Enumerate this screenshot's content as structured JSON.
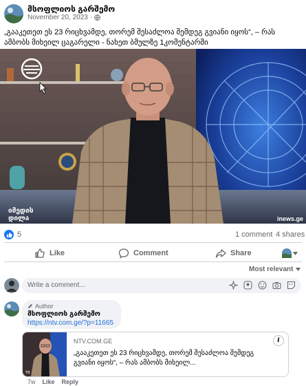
{
  "post": {
    "page_name": "მსოფლიოს გარშემო",
    "date": "November 20, 2023",
    "privacy_icon": "globe-icon",
    "more_icon": "more-icon",
    "caption": "„გააკეთეთ ეს 23 რიცხვამდე, თორემ შესაძლოა შემდეგ გვიანი იყოს“, – რას ამბობს მიხეილ ცაგარელი - ნახეთ ბმულზე 1კომენტარში"
  },
  "photo": {
    "logo_text": "იმედის დილა",
    "watermark": "inews.ge"
  },
  "stats": {
    "likes": "5",
    "comments": "1 comment",
    "shares": "4 shares"
  },
  "actions": {
    "like": "Like",
    "comment": "Comment",
    "share": "Share"
  },
  "sort": {
    "label": "Most relevant"
  },
  "composer": {
    "placeholder": "Write a comment..."
  },
  "comment": {
    "author_badge": "Author",
    "author_name": "მსოფლიოს გარშემო",
    "link_url": "https://ntv.com.ge/?p=11665",
    "preview": {
      "domain": "NTV.COM.GE",
      "title": "„გააკეთეთ ეს 23 რიცხვამდე, თორემ შესაძლოა შემდეგ გვიანი იყოს“, – რას ამბობს მიხეილ..."
    },
    "time": "7w",
    "like": "Like",
    "reply": "Reply"
  },
  "colors": {
    "accent": "#1877f2",
    "muted": "#65676b",
    "bubble": "#f0f2f5"
  }
}
